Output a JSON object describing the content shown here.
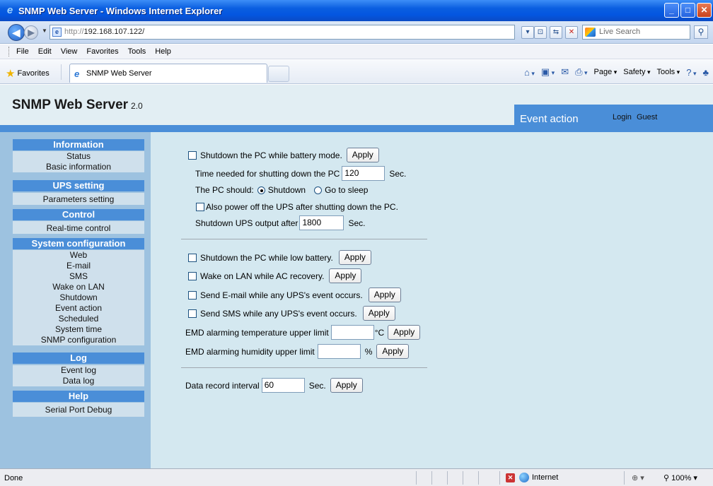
{
  "window": {
    "title": "SNMP Web Server - Windows Internet Explorer",
    "url_protocol": "http://",
    "url_host": "192.168.107.122/",
    "search_placeholder": "Live Search"
  },
  "menu": [
    "File",
    "Edit",
    "View",
    "Favorites",
    "Tools",
    "Help"
  ],
  "favorites_bar": {
    "favorites_label": "Favorites",
    "tab_title": "SNMP Web Server",
    "commands": [
      "Page",
      "Safety",
      "Tools"
    ]
  },
  "header": {
    "app_title": "SNMP Web Server",
    "version": "2.0",
    "page_title": "Event action",
    "login_label": "Login",
    "user": "Guest"
  },
  "sidebar": {
    "sections": [
      {
        "title": "Information",
        "items": [
          "Status",
          "Basic information"
        ]
      },
      {
        "title": "UPS setting",
        "items": [
          "Parameters setting"
        ]
      },
      {
        "title": "Control",
        "items": [
          "Real-time control"
        ]
      },
      {
        "title": "System configuration",
        "items": [
          "Web",
          "E-mail",
          "SMS",
          "Wake on LAN",
          "Shutdown",
          "Event action",
          "Scheduled",
          "System time",
          "SNMP configuration"
        ]
      },
      {
        "title": "Log",
        "items": [
          "Event log",
          "Data log"
        ]
      },
      {
        "title": "Help",
        "items": [
          "Serial Port Debug"
        ]
      }
    ]
  },
  "form": {
    "apply_label": "Apply",
    "sec_unit": "Sec.",
    "shutdown_battery_label": "Shutdown the PC while battery mode.",
    "time_needed_label": "Time needed for shutting down the PC",
    "time_needed_value": "120",
    "pc_should_label": "The PC should:",
    "radio_shutdown_label": "Shutdown",
    "radio_sleep_label": "Go to sleep",
    "power_off_ups_label": "Also power off the UPS after shutting down the PC.",
    "shutdown_ups_label": "Shutdown UPS output after",
    "shutdown_ups_value": "1800",
    "low_battery_label": "Shutdown the PC while low battery.",
    "wol_label": "Wake on LAN while AC recovery.",
    "email_label": "Send E-mail while any UPS's event occurs.",
    "sms_label": "Send SMS while any UPS's event occurs.",
    "emd_temp_label": "EMD alarming temperature upper limit",
    "emd_temp_value": "",
    "emd_temp_unit": "°C",
    "emd_hum_label": "EMD alarming humidity upper limit",
    "emd_hum_value": "",
    "emd_hum_unit": "%",
    "data_interval_label": "Data record interval",
    "data_interval_value": "60"
  },
  "statusbar": {
    "status": "Done",
    "zone": "Internet",
    "zoom": "100%"
  }
}
